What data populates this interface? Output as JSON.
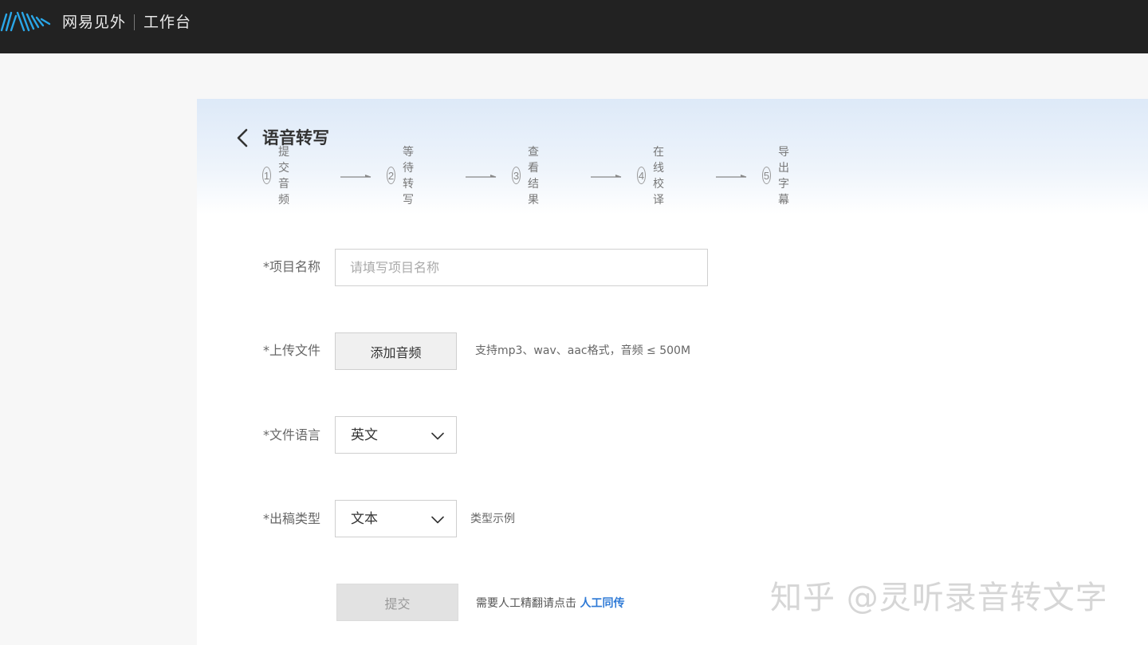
{
  "header": {
    "brand": "网易见外",
    "workbench": "工作台"
  },
  "page": {
    "title": "语音转写"
  },
  "steps": [
    {
      "num": "1",
      "label": "提交音频"
    },
    {
      "num": "2",
      "label": "等待转写"
    },
    {
      "num": "3",
      "label": "查看结果"
    },
    {
      "num": "4",
      "label": "在线校译"
    },
    {
      "num": "5",
      "label": "导出字幕"
    }
  ],
  "form": {
    "project_name_label": "*项目名称",
    "project_name_placeholder": "请填写项目名称",
    "project_name_value": "",
    "upload_label": "*上传文件",
    "add_audio_button": "添加音频",
    "upload_hint": "支持mp3、wav、aac格式，音频 ≤ 500M",
    "language_label": "*文件语言",
    "language_value": "英文",
    "output_type_label": "*出稿类型",
    "output_type_value": "文本",
    "type_example_link": "类型示例",
    "submit_button": "提交",
    "manual_hint": "需要人工精翻请点击",
    "manual_link": "人工同传"
  },
  "watermark": "知乎 @灵听录音转文字",
  "colors": {
    "topbar": "#222222",
    "accent_link": "#2f7ad6",
    "logo_blue": "#2aa7e8"
  }
}
